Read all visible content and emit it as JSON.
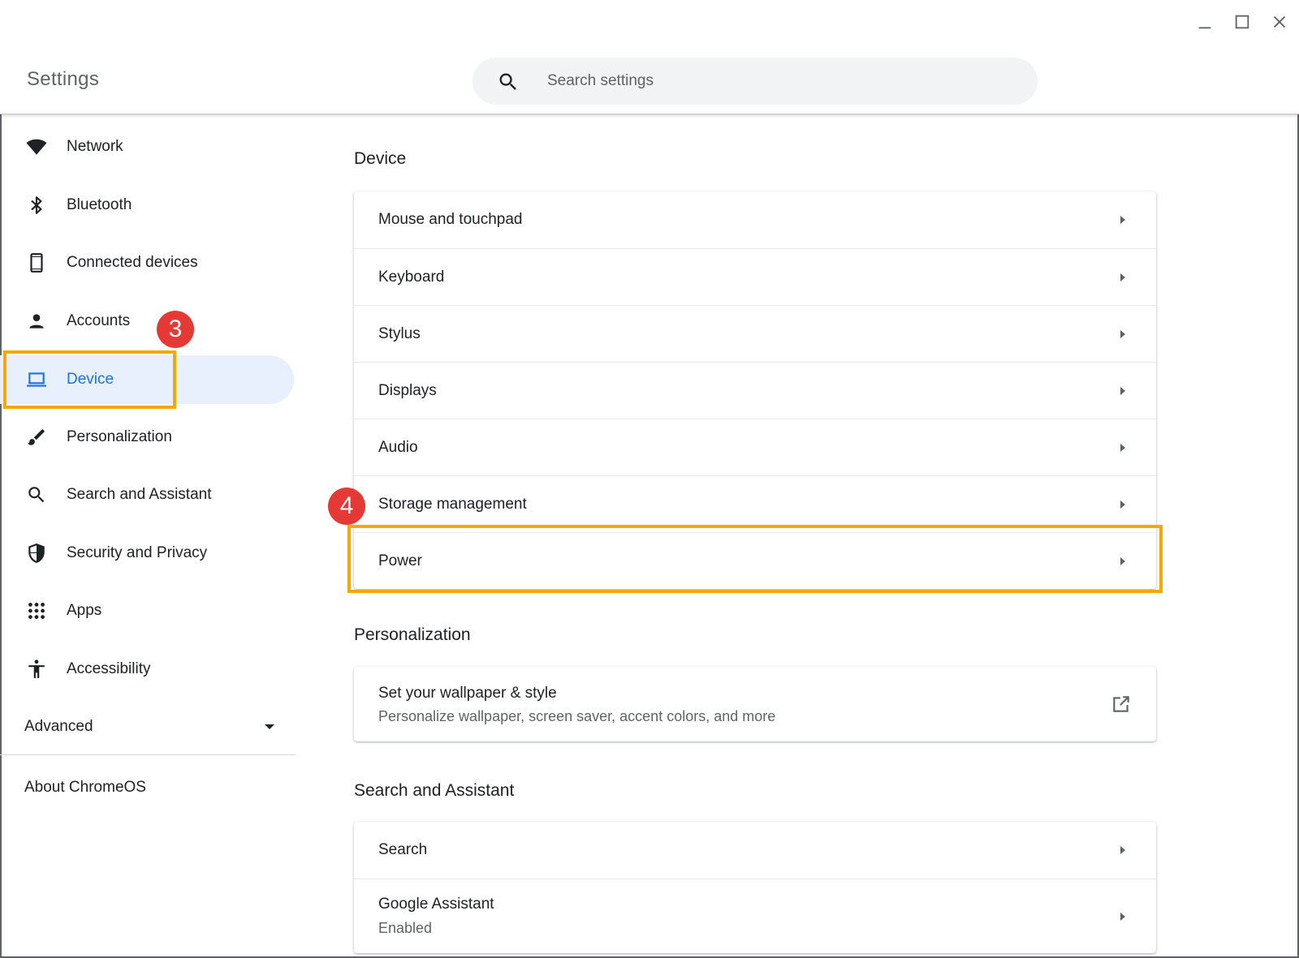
{
  "window": {
    "minimize_icon": "minimize-icon",
    "maximize_icon": "maximize-icon",
    "close_icon": "close-icon"
  },
  "header": {
    "title": "Settings",
    "search_placeholder": "Search settings"
  },
  "sidebar": {
    "items": [
      {
        "label": "Network",
        "icon": "wifi-icon"
      },
      {
        "label": "Bluetooth",
        "icon": "bluetooth-icon"
      },
      {
        "label": "Connected devices",
        "icon": "phone-icon"
      },
      {
        "label": "Accounts",
        "icon": "person-icon"
      },
      {
        "label": "Device",
        "icon": "laptop-icon",
        "active": true
      },
      {
        "label": "Personalization",
        "icon": "brush-icon"
      },
      {
        "label": "Search and Assistant",
        "icon": "search-icon"
      },
      {
        "label": "Security and Privacy",
        "icon": "shield-icon"
      },
      {
        "label": "Apps",
        "icon": "apps-grid-icon"
      },
      {
        "label": "Accessibility",
        "icon": "accessibility-icon"
      }
    ],
    "advanced_label": "Advanced",
    "about_label": "About ChromeOS"
  },
  "annotations": {
    "step3": "3",
    "step4": "4",
    "highlight_color": "#f6a800",
    "badge_color": "#e53935"
  },
  "main": {
    "device": {
      "title": "Device",
      "rows": [
        "Mouse and touchpad",
        "Keyboard",
        "Stylus",
        "Displays",
        "Audio",
        "Storage management",
        "Power"
      ]
    },
    "personalization": {
      "title": "Personalization",
      "row_title": "Set your wallpaper & style",
      "row_sub": "Personalize wallpaper, screen saver, accent colors, and more"
    },
    "search_assistant": {
      "title": "Search and Assistant",
      "search_label": "Search",
      "assistant_label": "Google Assistant",
      "assistant_status": "Enabled"
    }
  },
  "colors": {
    "accent": "#1a73e8",
    "active_bg": "#e8f0fe"
  }
}
